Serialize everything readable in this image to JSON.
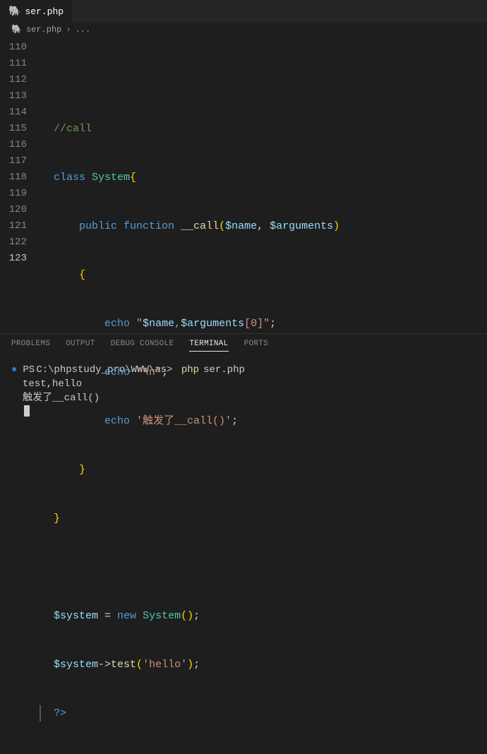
{
  "tab": {
    "filename": "ser.php"
  },
  "breadcrumb": {
    "filename": "ser.php",
    "rest": "..."
  },
  "lines": {
    "start": 110,
    "end": 123,
    "active": 123
  },
  "code": {
    "l111_comment": "//call",
    "l112_class": "class",
    "l112_name": "System",
    "l112_brace": "{",
    "l113_public": "public",
    "l113_function": "function",
    "l113_fname": "__call",
    "l113_p1": "$name",
    "l113_p2": "$arguments",
    "l114_brace": "{",
    "l115_echo": "echo",
    "l115_str_a": "\"",
    "l115_v1": "$name",
    "l115_comma": ",",
    "l115_v2": "$arguments",
    "l115_idx_open": "[",
    "l115_idx": "0",
    "l115_idx_close": "]",
    "l115_str_b": "\"",
    "l116_echo": "echo",
    "l116_str": "\"\\n\"",
    "l117_echo": "echo",
    "l117_str": "'触发了__call()'",
    "l118_brace": "}",
    "l119_brace": "}",
    "l121_var": "$system",
    "l121_eq": " = ",
    "l121_new": "new",
    "l121_cls": "System",
    "l122_var": "$system",
    "l122_arrow": "->",
    "l122_method": "test",
    "l122_arg": "'hello'",
    "l123_close": "?>"
  },
  "panel": {
    "tabs": [
      "PROBLEMS",
      "OUTPUT",
      "DEBUG CONSOLE",
      "TERMINAL",
      "PORTS"
    ],
    "active": 3
  },
  "terminal": {
    "prompt_prefix": "PS ",
    "prompt_path": "C:\\phpstudy_pro\\WWW\\as>",
    "cmd": "php",
    "arg": "ser.php",
    "out1": "test,hello",
    "out2": "触发了__call()"
  }
}
